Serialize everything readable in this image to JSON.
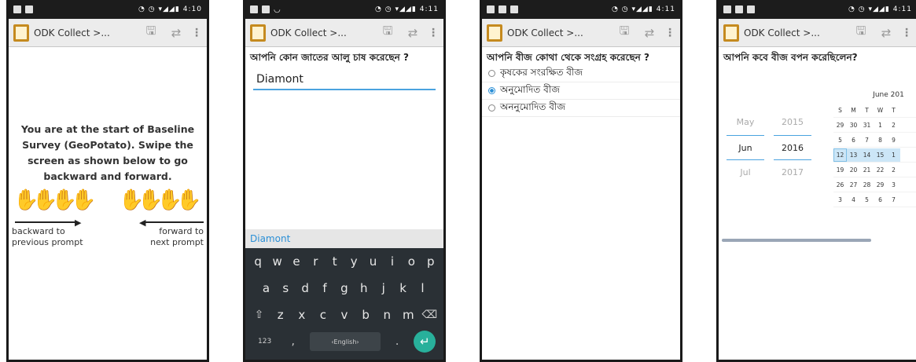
{
  "status": {
    "p1_time": "4:10",
    "p2_time": "4:11",
    "p3_time": "4:11",
    "p4_time": "4:11"
  },
  "appbar": {
    "title": "ODK Collect >..."
  },
  "screen1": {
    "intro": "You are at the start of Baseline Survey (GeoPotato). Swipe the screen as shown below to go backward and forward.",
    "backward_hint": "backward to previous prompt",
    "forward_hint": "forward to next prompt"
  },
  "screen2": {
    "question": "আপনি কোন জাতের আলু চাষ করেছেন ?",
    "answer": "Diamont",
    "suggestion": "Diamont",
    "keys_row1": [
      "q",
      "w",
      "e",
      "r",
      "t",
      "y",
      "u",
      "i",
      "o",
      "p"
    ],
    "keys_row2": [
      "a",
      "s",
      "d",
      "f",
      "g",
      "h",
      "j",
      "k",
      "l"
    ],
    "keys_row3": [
      "z",
      "x",
      "c",
      "v",
      "b",
      "n",
      "m"
    ],
    "key_numbers": "123",
    "key_space": "English"
  },
  "screen3": {
    "question": "আপনি বীজ কোথা থেকে সংগ্রহ করেছেন ?",
    "options": [
      {
        "label": "কৃষকের সংরক্ষিত বীজ",
        "selected": false
      },
      {
        "label": "অনুমোদিত বীজ",
        "selected": true
      },
      {
        "label": "অননুমোদিত বীজ",
        "selected": false
      }
    ]
  },
  "screen4": {
    "question": "আপনি কবে বীজ বপন করেছিলেন?",
    "months": [
      "May",
      "Jun",
      "Jul"
    ],
    "years": [
      "2015",
      "2016",
      "2017"
    ],
    "calendar_title": "June 201",
    "weekdays": [
      "S",
      "M",
      "T",
      "W",
      "T"
    ],
    "weeks": [
      [
        "29",
        "30",
        "31",
        "1",
        "2"
      ],
      [
        "5",
        "6",
        "7",
        "8",
        "9"
      ],
      [
        "12",
        "13",
        "14",
        "15",
        "1"
      ],
      [
        "19",
        "20",
        "21",
        "22",
        "2"
      ],
      [
        "26",
        "27",
        "28",
        "29",
        "3"
      ],
      [
        "3",
        "4",
        "5",
        "6",
        "7"
      ]
    ]
  },
  "colors": {
    "accent": "#4aa3df",
    "keyboard_bg": "#2a3035",
    "enter": "#28b09b",
    "app_icon": "#c58a1f"
  }
}
